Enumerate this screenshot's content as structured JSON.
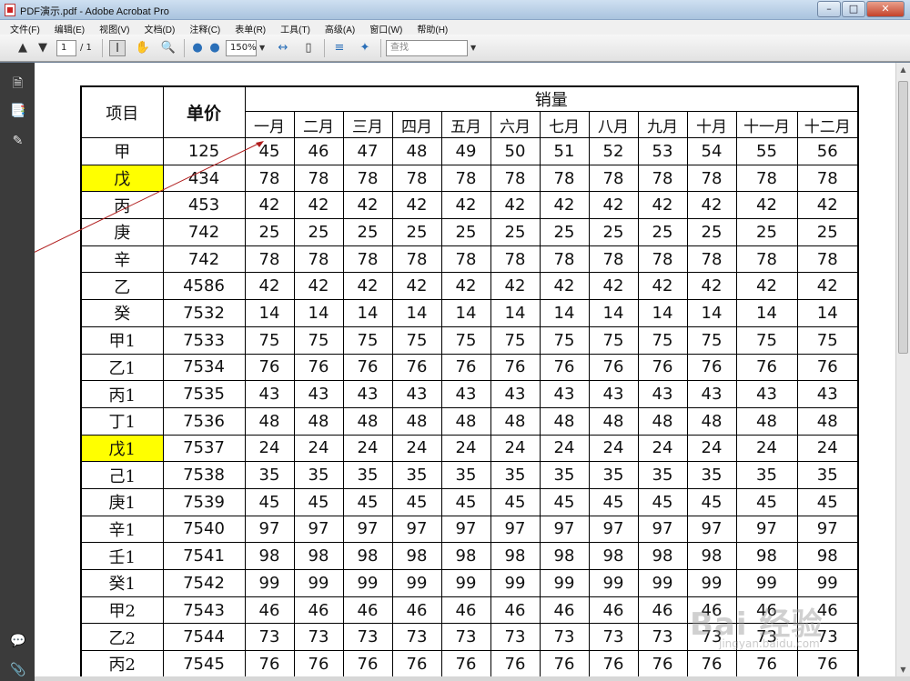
{
  "window": {
    "title": "PDF演示.pdf - Adobe Acrobat Pro",
    "minimize": "–",
    "maximize": "□",
    "close": "✕"
  },
  "menu": [
    "文件(F)",
    "编辑(E)",
    "视图(V)",
    "文档(D)",
    "注释(C)",
    "表单(R)",
    "工具(T)",
    "高级(A)",
    "窗口(W)",
    "帮助(H)"
  ],
  "toolbar": {
    "page_current": "1",
    "page_total": "/ 1",
    "zoom": "150%",
    "search_placeholder": "查找"
  },
  "table": {
    "header_item": "项目",
    "header_price": "单价",
    "header_sales": "销量",
    "months": [
      "一月",
      "二月",
      "三月",
      "四月",
      "五月",
      "六月",
      "七月",
      "八月",
      "九月",
      "十月",
      "十一月",
      "十二月"
    ],
    "rows": [
      {
        "name": "甲",
        "price": "125",
        "highlight": false,
        "sales": [
          "45",
          "46",
          "47",
          "48",
          "49",
          "50",
          "51",
          "52",
          "53",
          "54",
          "55",
          "56"
        ]
      },
      {
        "name": "戊",
        "price": "434",
        "highlight": true,
        "sales": [
          "78",
          "78",
          "78",
          "78",
          "78",
          "78",
          "78",
          "78",
          "78",
          "78",
          "78",
          "78"
        ]
      },
      {
        "name": "丙",
        "price": "453",
        "highlight": false,
        "sales": [
          "42",
          "42",
          "42",
          "42",
          "42",
          "42",
          "42",
          "42",
          "42",
          "42",
          "42",
          "42"
        ]
      },
      {
        "name": "庚",
        "price": "742",
        "highlight": false,
        "sales": [
          "25",
          "25",
          "25",
          "25",
          "25",
          "25",
          "25",
          "25",
          "25",
          "25",
          "25",
          "25"
        ]
      },
      {
        "name": "辛",
        "price": "742",
        "highlight": false,
        "sales": [
          "78",
          "78",
          "78",
          "78",
          "78",
          "78",
          "78",
          "78",
          "78",
          "78",
          "78",
          "78"
        ]
      },
      {
        "name": "乙",
        "price": "4586",
        "highlight": false,
        "sales": [
          "42",
          "42",
          "42",
          "42",
          "42",
          "42",
          "42",
          "42",
          "42",
          "42",
          "42",
          "42"
        ]
      },
      {
        "name": "癸",
        "price": "7532",
        "highlight": false,
        "sales": [
          "14",
          "14",
          "14",
          "14",
          "14",
          "14",
          "14",
          "14",
          "14",
          "14",
          "14",
          "14"
        ]
      },
      {
        "name": "甲1",
        "price": "7533",
        "highlight": false,
        "sales": [
          "75",
          "75",
          "75",
          "75",
          "75",
          "75",
          "75",
          "75",
          "75",
          "75",
          "75",
          "75"
        ]
      },
      {
        "name": "乙1",
        "price": "7534",
        "highlight": false,
        "sales": [
          "76",
          "76",
          "76",
          "76",
          "76",
          "76",
          "76",
          "76",
          "76",
          "76",
          "76",
          "76"
        ]
      },
      {
        "name": "丙1",
        "price": "7535",
        "highlight": false,
        "sales": [
          "43",
          "43",
          "43",
          "43",
          "43",
          "43",
          "43",
          "43",
          "43",
          "43",
          "43",
          "43"
        ]
      },
      {
        "name": "丁1",
        "price": "7536",
        "highlight": false,
        "sales": [
          "48",
          "48",
          "48",
          "48",
          "48",
          "48",
          "48",
          "48",
          "48",
          "48",
          "48",
          "48"
        ]
      },
      {
        "name": "戊1",
        "price": "7537",
        "highlight": true,
        "sales": [
          "24",
          "24",
          "24",
          "24",
          "24",
          "24",
          "24",
          "24",
          "24",
          "24",
          "24",
          "24"
        ]
      },
      {
        "name": "己1",
        "price": "7538",
        "highlight": false,
        "sales": [
          "35",
          "35",
          "35",
          "35",
          "35",
          "35",
          "35",
          "35",
          "35",
          "35",
          "35",
          "35"
        ]
      },
      {
        "name": "庚1",
        "price": "7539",
        "highlight": false,
        "sales": [
          "45",
          "45",
          "45",
          "45",
          "45",
          "45",
          "45",
          "45",
          "45",
          "45",
          "45",
          "45"
        ]
      },
      {
        "name": "辛1",
        "price": "7540",
        "highlight": false,
        "sales": [
          "97",
          "97",
          "97",
          "97",
          "97",
          "97",
          "97",
          "97",
          "97",
          "97",
          "97",
          "97"
        ]
      },
      {
        "name": "壬1",
        "price": "7541",
        "highlight": false,
        "sales": [
          "98",
          "98",
          "98",
          "98",
          "98",
          "98",
          "98",
          "98",
          "98",
          "98",
          "98",
          "98"
        ]
      },
      {
        "name": "癸1",
        "price": "7542",
        "highlight": false,
        "sales": [
          "99",
          "99",
          "99",
          "99",
          "99",
          "99",
          "99",
          "99",
          "99",
          "99",
          "99",
          "99"
        ]
      },
      {
        "name": "甲2",
        "price": "7543",
        "highlight": false,
        "sales": [
          "46",
          "46",
          "46",
          "46",
          "46",
          "46",
          "46",
          "46",
          "46",
          "46",
          "46",
          "46"
        ]
      },
      {
        "name": "乙2",
        "price": "7544",
        "highlight": false,
        "sales": [
          "73",
          "73",
          "73",
          "73",
          "73",
          "73",
          "73",
          "73",
          "73",
          "73",
          "73",
          "73"
        ]
      },
      {
        "name": "丙2",
        "price": "7545",
        "highlight": false,
        "sales": [
          "76",
          "76",
          "76",
          "76",
          "76",
          "76",
          "76",
          "76",
          "76",
          "76",
          "76",
          "76"
        ]
      }
    ]
  },
  "colors": {
    "highlight": "#ffff00",
    "annotation_line": "#b01c1c"
  },
  "watermark": "Bai 经验",
  "watermark_sub": "jingyan.baidu.com"
}
